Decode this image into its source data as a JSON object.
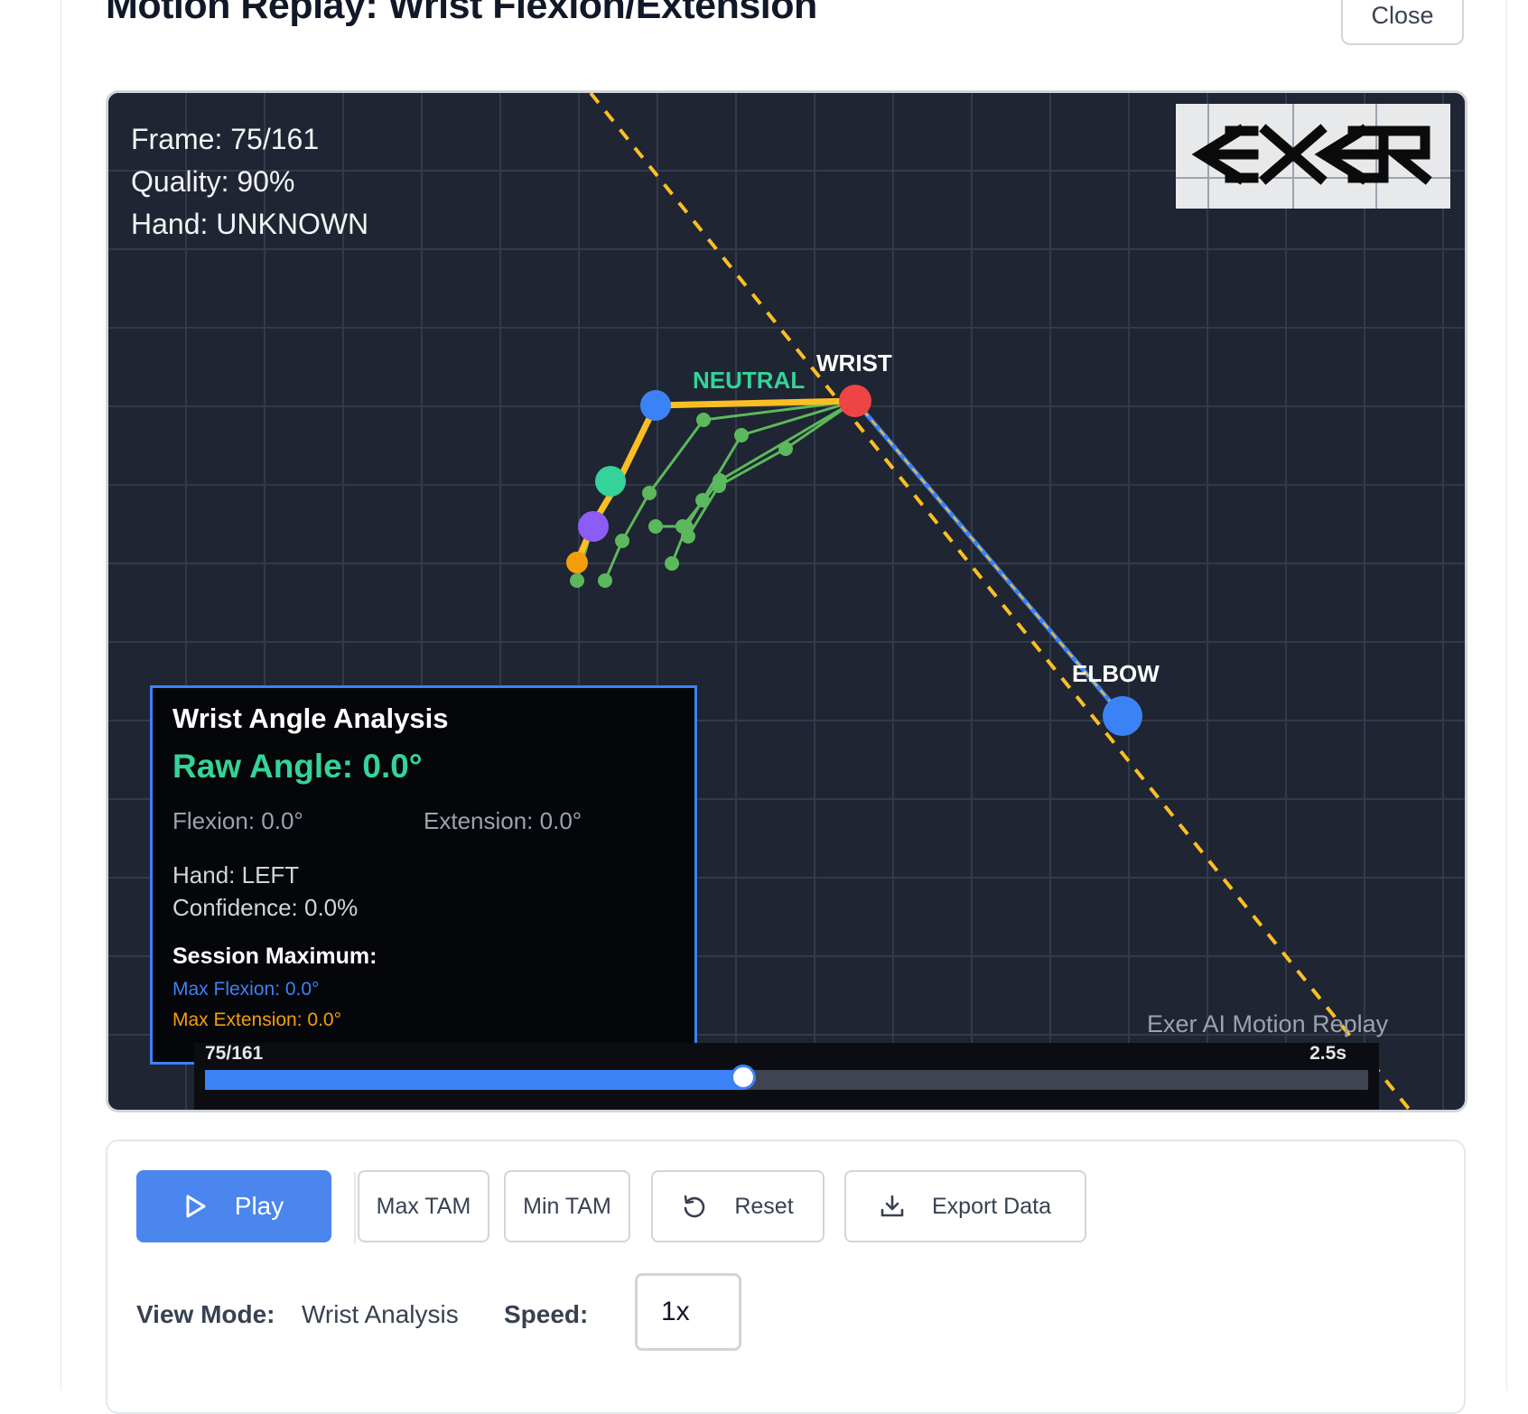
{
  "header": {
    "title": "Motion Replay: Wrist Flexion/Extension",
    "close_label": "Close"
  },
  "replay": {
    "frame_text": "Frame: 75/161",
    "quality_text": "Quality: 90%",
    "hand_text": "Hand: UNKNOWN",
    "logo_text": "EXER",
    "labels": {
      "wrist": "WRIST",
      "neutral": "NEUTRAL",
      "elbow": "ELBOW"
    },
    "watermark": "Exer AI Motion Replay",
    "colors": {
      "canvas_bg": "#1f2532",
      "grid": "#323a4a",
      "reference_line": "#fbbf24",
      "finger": "#5cb85c",
      "wrist_joint": "#ef4444",
      "elbow_joint": "#3b82f6",
      "neutral_label": "#34d399"
    }
  },
  "analysis": {
    "title": "Wrist Angle Analysis",
    "raw_angle": "Raw Angle: 0.0°",
    "flexion": "Flexion: 0.0°",
    "extension": "Extension: 0.0°",
    "hand": "Hand: LEFT",
    "confidence": "Confidence: 0.0%",
    "session_max_title": "Session Maximum:",
    "max_flexion": "Max Flexion: 0.0°",
    "max_extension": "Max Extension: 0.0°"
  },
  "scrubber": {
    "frame_label": "75/161",
    "time_label": "2.5s",
    "progress": 0.4625
  },
  "controls": {
    "play_label": "Play",
    "max_tam_label": "Max TAM",
    "min_tam_label": "Min TAM",
    "reset_label": "Reset",
    "export_label": "Export Data",
    "view_mode_label": "View Mode:",
    "view_mode_value": "Wrist Analysis",
    "speed_label": "Speed:",
    "speed_value": "1x"
  }
}
